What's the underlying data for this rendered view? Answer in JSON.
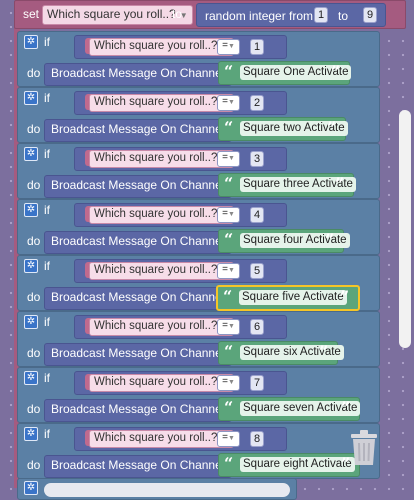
{
  "set_block": {
    "set_label": "set",
    "variable": "Which square you roll..?",
    "to_label": "to",
    "random_label": "random integer from",
    "from_value": "1",
    "random_to_label": "to",
    "to_value": "9"
  },
  "if_label": "if",
  "do_label": "do",
  "broadcast_label": "Broadcast Message On Channel",
  "compare_variable": "Which square you roll..?",
  "operator": "=",
  "rules": [
    {
      "value": "1",
      "message": "Square One Activate"
    },
    {
      "value": "2",
      "message": "Square two Activate"
    },
    {
      "value": "3",
      "message": "Square three Activate"
    },
    {
      "value": "4",
      "message": "Square four Activate"
    },
    {
      "value": "5",
      "message": "Square five Activate",
      "selected": true
    },
    {
      "value": "6",
      "message": "Square six Activate"
    },
    {
      "value": "7",
      "message": "Square seven Activate"
    },
    {
      "value": "8",
      "message": "Square eight Activate"
    }
  ],
  "colors": {
    "variable_block": "#a55b80",
    "control_block": "#5b80a5",
    "math_block": "#5b67a5",
    "text_block": "#5ba57b",
    "selection": "#f5c527"
  },
  "icons": {
    "mutator": "gear-icon",
    "trash": "trash-icon",
    "dropdown": "chevron-down-icon"
  }
}
